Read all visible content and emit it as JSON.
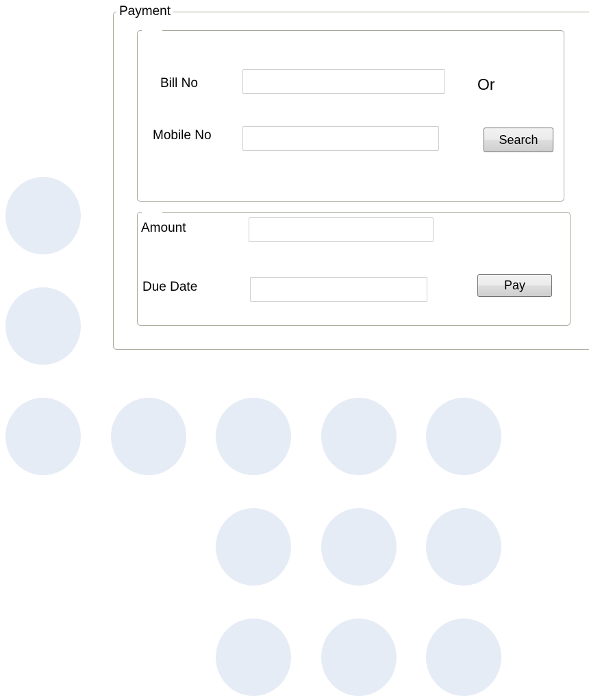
{
  "payment_group": {
    "title": "Payment"
  },
  "search_section": {
    "bill_no_label": "Bill No",
    "bill_no_value": "",
    "or_label": "Or",
    "mobile_no_label": "Mobile No",
    "mobile_no_value": "",
    "search_button_label": "Search"
  },
  "pay_section": {
    "amount_label": "Amount",
    "amount_value": "",
    "due_date_label": "Due Date",
    "due_date_value": "",
    "pay_button_label": "Pay"
  },
  "colors": {
    "background": "#ffffff",
    "dot": "#e6ecf5",
    "border": "#a9a99a"
  }
}
